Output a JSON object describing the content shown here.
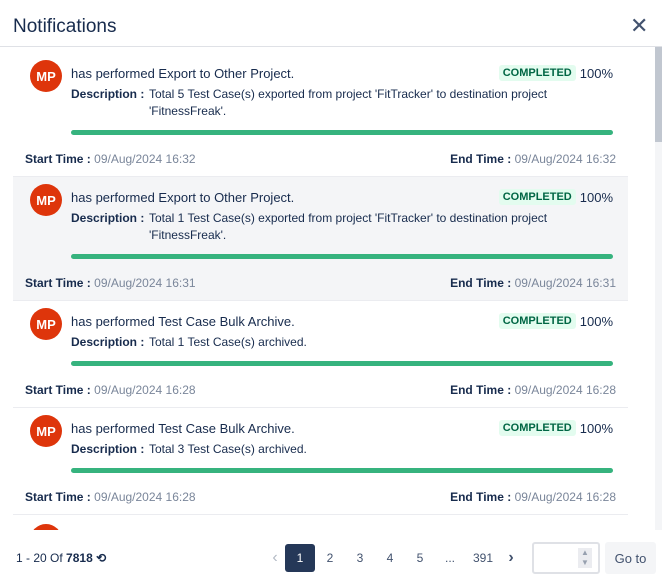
{
  "header": {
    "title": "Notifications",
    "close_icon": "close-icon"
  },
  "labels": {
    "description": "Description :",
    "start": "Start Time :",
    "end": "End Time :"
  },
  "colors": {
    "avatar": "#de350b",
    "progress": "#36b37e",
    "badge_bg": "#e3fcef",
    "active_page": "#253858"
  },
  "items": [
    {
      "initials": "MP",
      "action": "has performed Export to Other Project.",
      "status": "COMPLETED",
      "progress": "100%",
      "description": "Total 5 Test Case(s) exported from project 'FitTracker' to destination project 'FitnessFreak'.",
      "start": "09/Aug/2024 16:32",
      "end": "09/Aug/2024 16:32"
    },
    {
      "initials": "MP",
      "action": "has performed Export to Other Project.",
      "status": "COMPLETED",
      "progress": "100%",
      "description": "Total 1 Test Case(s) exported from project 'FitTracker' to destination project 'FitnessFreak'.",
      "start": "09/Aug/2024 16:31",
      "end": "09/Aug/2024 16:31"
    },
    {
      "initials": "MP",
      "action": "has performed Test Case Bulk Archive.",
      "status": "COMPLETED",
      "progress": "100%",
      "description": "Total 1 Test Case(s) archived.",
      "start": "09/Aug/2024 16:28",
      "end": "09/Aug/2024 16:28"
    },
    {
      "initials": "MP",
      "action": "has performed Test Case Bulk Archive.",
      "status": "COMPLETED",
      "progress": "100%",
      "description": "Total 3 Test Case(s) archived.",
      "start": "09/Aug/2024 16:28",
      "end": "09/Aug/2024 16:28"
    }
  ],
  "footer": {
    "range": "1 - 20",
    "of": "Of",
    "total": "7818",
    "pages": [
      "1",
      "2",
      "3",
      "4",
      "5",
      "...",
      "391"
    ],
    "current_page": "1",
    "goto_value": "",
    "goto_label": "Go to"
  }
}
